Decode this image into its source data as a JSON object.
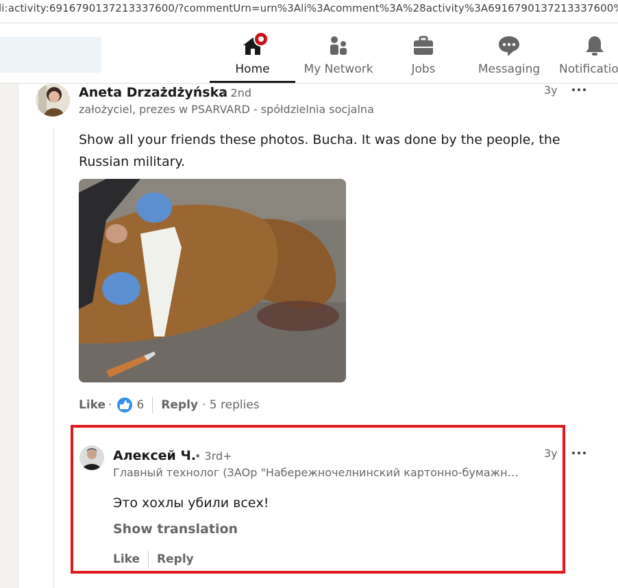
{
  "browser": {
    "url": "li:activity:6916790137213337600/?commentUrn=urn%3Ali%3Acomment%3A%28activity%3A6916790137213337600%"
  },
  "nav": {
    "items": [
      {
        "label": "Home",
        "icon": "home-icon",
        "active": true
      },
      {
        "label": "My Network",
        "icon": "network-icon"
      },
      {
        "label": "Jobs",
        "icon": "briefcase-icon"
      },
      {
        "label": "Messaging",
        "icon": "messaging-icon"
      },
      {
        "label": "Notifications",
        "icon": "bell-icon"
      }
    ]
  },
  "comment": {
    "author": "Aneta Drzażdżyńska",
    "degree": "• 2nd",
    "headline": "założyciel, prezes w PSARVARD - spółdzielnia socjalna",
    "time": "3y",
    "text": "Show all your friends these photos. Bucha. It was done by the people, the Russian military.",
    "like_label": "Like",
    "reaction_count": "6",
    "reply_label": "Reply",
    "replies": "· 5 replies"
  },
  "reply": {
    "author": "Алексей Ч.",
    "degree": "• 3rd+",
    "headline": "Главный технолог (ЗАОр \"Набережночелнинский картонно-бумажн…",
    "time": "3y",
    "text": "Это хохлы убили всех!",
    "show_translation": "Show translation",
    "like_label": "Like",
    "reply_label": "Reply"
  },
  "colors": {
    "highlight_border": "#e0191e",
    "like_blue": "#378fe9",
    "notification_red": "#cc1016"
  }
}
